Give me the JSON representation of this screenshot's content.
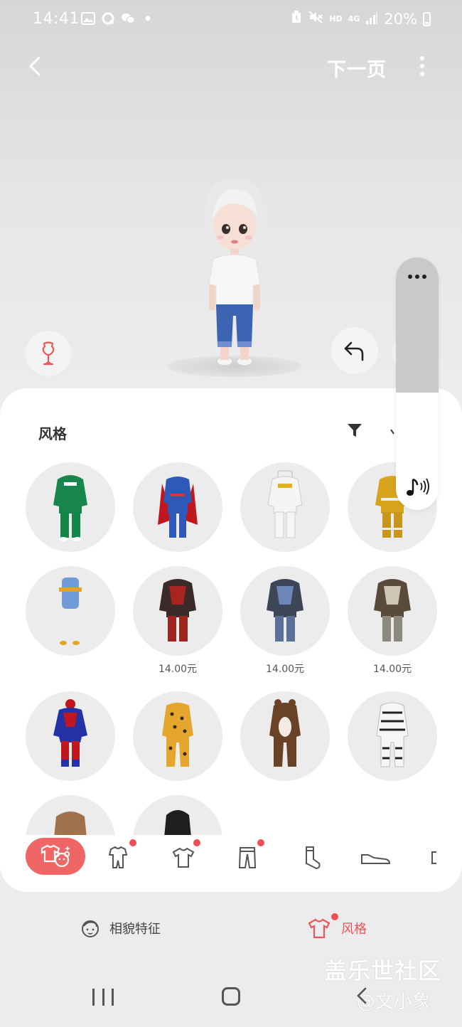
{
  "status_bar": {
    "time": "14:41",
    "network_hd": "HD",
    "network_gen": "4G",
    "battery": "20%"
  },
  "header": {
    "next_label": "下一页"
  },
  "sheet": {
    "title": "风格",
    "items": [
      {
        "outfit": "green-tracksuit",
        "price": ""
      },
      {
        "outfit": "blue-red-hero-suit",
        "price": ""
      },
      {
        "outfit": "white-space-suit",
        "price": ""
      },
      {
        "outfit": "yellow-firefighter-suit",
        "price": ""
      },
      {
        "outfit": "blue-backpack-set",
        "price": ""
      },
      {
        "outfit": "red-armor",
        "price": "14.00元"
      },
      {
        "outfit": "blue-armor",
        "price": "14.00元"
      },
      {
        "outfit": "bone-armor",
        "price": "14.00元"
      },
      {
        "outfit": "red-blue-hero-bodysuit",
        "price": ""
      },
      {
        "outfit": "leopard-onesie",
        "price": ""
      },
      {
        "outfit": "brown-bear-onesie",
        "price": ""
      },
      {
        "outfit": "zebra-onesie",
        "price": ""
      },
      {
        "outfit": "brown-coat",
        "price": ""
      },
      {
        "outfit": "black-suit",
        "price": ""
      }
    ]
  },
  "tabs": [
    {
      "name": "avatar-style-tab",
      "icon": "shirt-bear-icon",
      "active": true,
      "badge": false
    },
    {
      "name": "onesie-tab",
      "icon": "onesie-icon",
      "active": false,
      "badge": true
    },
    {
      "name": "tops-tab",
      "icon": "tshirt-icon",
      "active": false,
      "badge": true
    },
    {
      "name": "pants-tab",
      "icon": "pants-icon",
      "active": false,
      "badge": true
    },
    {
      "name": "socks-tab",
      "icon": "sock-icon",
      "active": false,
      "badge": false
    },
    {
      "name": "shoes-tab",
      "icon": "shoe-icon",
      "active": false,
      "badge": false
    }
  ],
  "modes": {
    "face_label": "相貌特征",
    "style_label": "风格"
  },
  "watermark": {
    "line1": "盖乐世社区",
    "line2": "@文小象"
  },
  "colors": {
    "accent": "#f06565",
    "badge": "#f04e55",
    "item_bg": "#ececed"
  }
}
